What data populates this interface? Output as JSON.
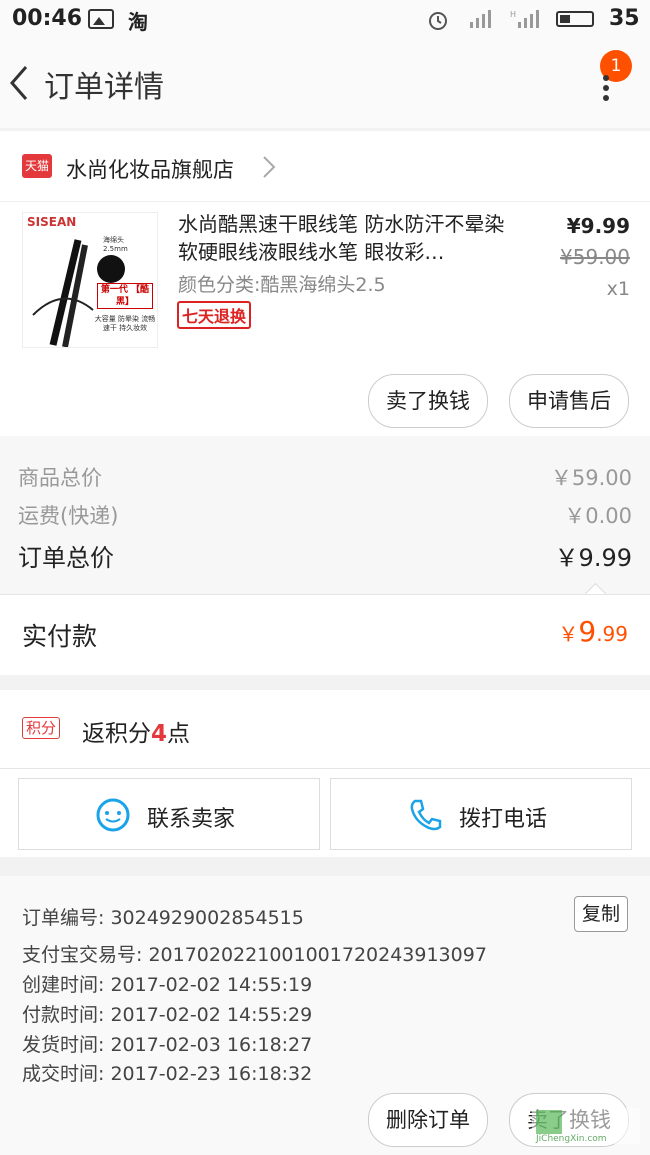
{
  "status": {
    "time": "00:46",
    "app_icon": "淘",
    "battery": "35"
  },
  "nav": {
    "title": "订单详情",
    "badge": "1"
  },
  "shop": {
    "tag": "天猫",
    "name": "水尚化妆品旗舰店"
  },
  "product": {
    "title": "水尚酷黑速干眼线笔 防水防汗不晕染软硬眼线液眼线水笔 眼妆彩…",
    "sku": "颜色分类:酷黑海绵头2.5",
    "tag": "七天退换",
    "price": "¥9.99",
    "old_price": "¥59.00",
    "qty": "x1",
    "image_text": {
      "brand": "SISEAN",
      "spec": "海绵头 2.5mm",
      "badge": "第一代 【酷黑】",
      "desc": "大容量 防晕染 流畅速干 持久妆效"
    }
  },
  "actions_top": {
    "exchange": "卖了换钱",
    "after_sale": "申请售后"
  },
  "summary": {
    "goods_label": "商品总价",
    "goods_value": "￥59.00",
    "ship_label": "运费(快递)",
    "ship_value": "￥0.00",
    "order_label": "订单总价",
    "order_value": "￥9.99",
    "paid_label": "实付款",
    "paid_symbol": "￥",
    "paid_int": "9",
    "paid_dec": ".99"
  },
  "points": {
    "tag": "积分",
    "prefix": "返积分",
    "value": "4",
    "suffix": "点"
  },
  "contact": {
    "seller": "联系卖家",
    "phone": "拨打电话"
  },
  "order_info": {
    "copy": "复制",
    "lines": [
      "订单编号: 3024929002854515",
      "支付宝交易号: 2017020221001001720243913097",
      "创建时间: 2017-02-02 14:55:19",
      "付款时间: 2017-02-02 14:55:29",
      "发货时间: 2017-02-03 16:18:27",
      "成交时间: 2017-02-23 16:18:32"
    ]
  },
  "actions_bottom": {
    "delete": "删除订单",
    "exchange": "卖了换钱"
  },
  "watermark": {
    "text": "JiChengXin.com"
  },
  "colors": {
    "accent": "#ff5000",
    "points": "#e4393c",
    "tmall": "#e4393c",
    "contact_icon": "#1aa3e8"
  }
}
